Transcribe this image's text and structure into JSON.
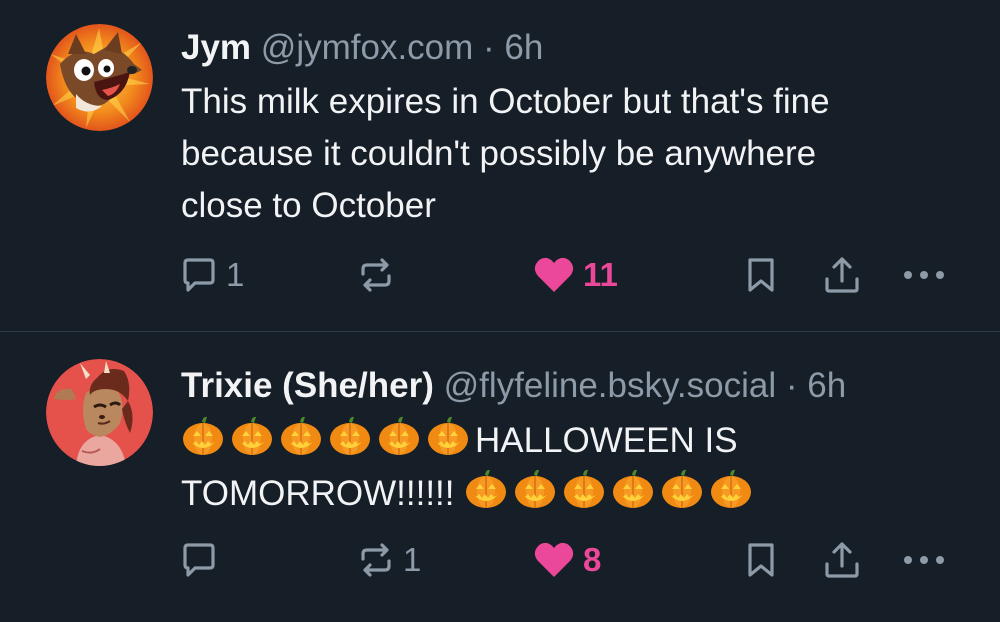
{
  "posts": [
    {
      "author_name": "Jym",
      "handle": "@jymfox.com",
      "separator": "·",
      "time": "6h",
      "text_lines": [
        "This milk expires in October but that's fine",
        "because it couldn't possibly be anywhere",
        "close to October"
      ],
      "reply_count": "1",
      "repost_count": "",
      "like_count": "11",
      "liked": true,
      "avatar_icon": "fox-avatar"
    },
    {
      "author_name": "Trixie (She/her)",
      "handle": "@flyfeline.bsky.social",
      "separator": "·",
      "time": "6h",
      "text_line_1": "HALLOWEEN IS",
      "text_line_2": "TOMORROW!!!!!!",
      "leading_emoji_count": 6,
      "trailing_emoji_count": 6,
      "emoji": "jack-o-lantern",
      "reply_count": "",
      "repost_count": "1",
      "like_count": "8",
      "liked": true,
      "avatar_icon": "deer-avatar"
    }
  ],
  "colors": {
    "background": "#161e27",
    "divider": "#2e3b48",
    "muted": "#8d9aa8",
    "like": "#ec4899",
    "text": "#f1f3f5"
  }
}
